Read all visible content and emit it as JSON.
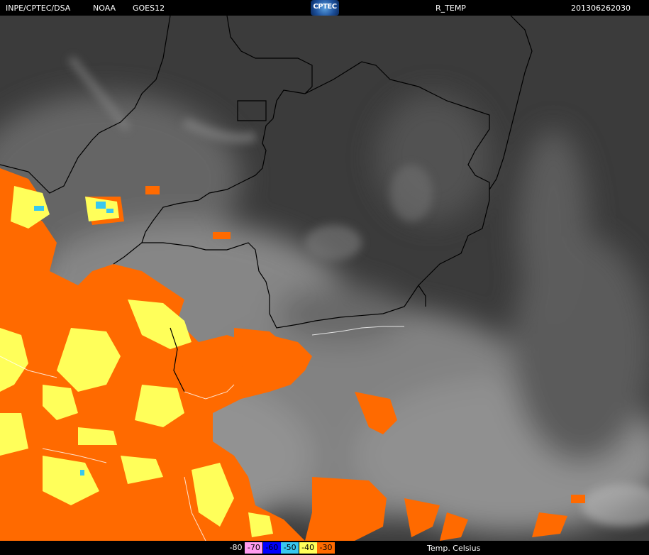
{
  "header": {
    "organization": "INPE/CPTEC/DSA",
    "agency": "NOAA",
    "satellite": "GOES12",
    "logo_text": "CPTEC",
    "product": "R_TEMP",
    "timestamp": "201306262030"
  },
  "legend": {
    "unit_label": "Temp. Celsius",
    "entries": [
      {
        "label": "-80",
        "color": "#000000",
        "text_color": "#ffffff"
      },
      {
        "label": "-70",
        "color": "#ff9cf0",
        "text_color": "#000000"
      },
      {
        "label": "-60",
        "color": "#0000ff",
        "text_color": "#000000"
      },
      {
        "label": "-50",
        "color": "#38c8f0",
        "text_color": "#000000"
      },
      {
        "label": "-40",
        "color": "#ffff5a",
        "text_color": "#000000"
      },
      {
        "label": "-30",
        "color": "#ff6a00",
        "text_color": "#000000"
      }
    ]
  },
  "colors": {
    "background_dark": "#3a3a3a",
    "cloud_gray": "#a8a8a8",
    "border_lines": "#000000",
    "coast_lines": "#ffffff"
  },
  "icons": [
    "cptec-logo",
    "state-border-lines",
    "coastline"
  ]
}
